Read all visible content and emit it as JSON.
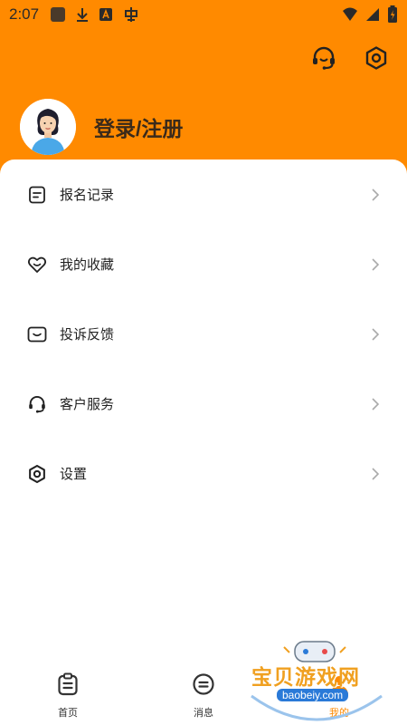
{
  "status_bar": {
    "time": "2:07",
    "left_icons": [
      "app-square-icon",
      "download-icon",
      "font-a-icon",
      "bug-icon"
    ],
    "right_icons": [
      "wifi-icon",
      "signal-icon",
      "battery-charging-icon"
    ]
  },
  "header": {
    "customer_service_icon": "headset-icon",
    "settings_icon": "hexagon-gear-icon"
  },
  "profile": {
    "login_text": "登录/注册"
  },
  "menu": {
    "items": [
      {
        "label": "报名记录",
        "icon": "document-icon"
      },
      {
        "label": "我的收藏",
        "icon": "heart-icon"
      },
      {
        "label": "投诉反馈",
        "icon": "message-box-icon"
      },
      {
        "label": "客户服务",
        "icon": "headset-icon"
      },
      {
        "label": "设置",
        "icon": "hexagon-gear-icon"
      }
    ]
  },
  "bottom_nav": {
    "items": [
      {
        "label": "首页",
        "icon": "home-clipboard-icon"
      },
      {
        "label": "消息",
        "icon": "message-circle-icon"
      },
      {
        "label": "我的",
        "icon": "profile-icon"
      }
    ],
    "active_index": 2
  },
  "watermark": {
    "title": "宝贝游戏网",
    "url": "baobeiy.com"
  },
  "colors": {
    "accent": "#ff8a00",
    "card": "#ffffff",
    "text": "#222222",
    "chevron": "#aaaaaa"
  }
}
